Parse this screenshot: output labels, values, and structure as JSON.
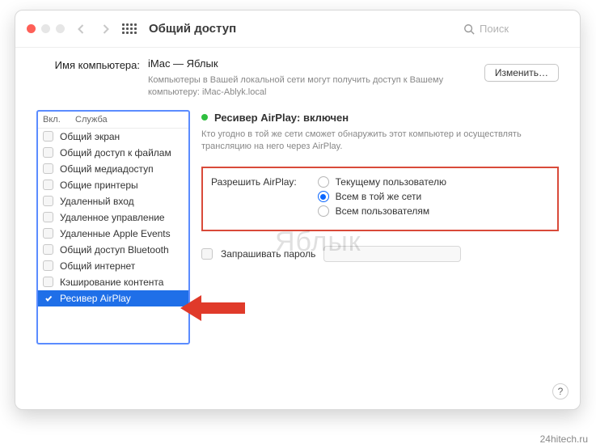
{
  "header": {
    "title": "Общий доступ",
    "search_placeholder": "Поиск"
  },
  "computer_name": {
    "label": "Имя компьютера:",
    "value": "iMac — Яблык",
    "hint_line1": "Компьютеры в Вашей локальной сети могут получить доступ к Вашему",
    "hint_line2": "компьютеру: iMac-Ablyk.local",
    "edit_button": "Изменить…"
  },
  "services": {
    "col_on": "Вкл.",
    "col_service": "Служба",
    "items": [
      {
        "label": "Общий экран",
        "on": false,
        "selected": false
      },
      {
        "label": "Общий доступ к файлам",
        "on": false,
        "selected": false
      },
      {
        "label": "Общий медиадоступ",
        "on": false,
        "selected": false
      },
      {
        "label": "Общие принтеры",
        "on": false,
        "selected": false
      },
      {
        "label": "Удаленный вход",
        "on": false,
        "selected": false
      },
      {
        "label": "Удаленное управление",
        "on": false,
        "selected": false
      },
      {
        "label": "Удаленные Apple Events",
        "on": false,
        "selected": false
      },
      {
        "label": "Общий доступ Bluetooth",
        "on": false,
        "selected": false
      },
      {
        "label": "Общий интернет",
        "on": false,
        "selected": false
      },
      {
        "label": "Кэширование контента",
        "on": false,
        "selected": false
      },
      {
        "label": "Ресивер AirPlay",
        "on": true,
        "selected": true
      }
    ]
  },
  "details": {
    "status_title": "Ресивер AirPlay: включен",
    "status_desc": "Кто угодно в той же сети сможет обнаружить этот компьютер и осуществлять трансляцию на него через AirPlay.",
    "allow_label": "Разрешить AirPlay:",
    "radios": [
      {
        "label": "Текущему пользователю",
        "selected": false
      },
      {
        "label": "Всем в той же сети",
        "selected": true
      },
      {
        "label": "Всем пользователям",
        "selected": false
      }
    ],
    "password_label": "Запрашивать пароль"
  },
  "watermark": "Яблык",
  "credit": "24hitech.ru"
}
